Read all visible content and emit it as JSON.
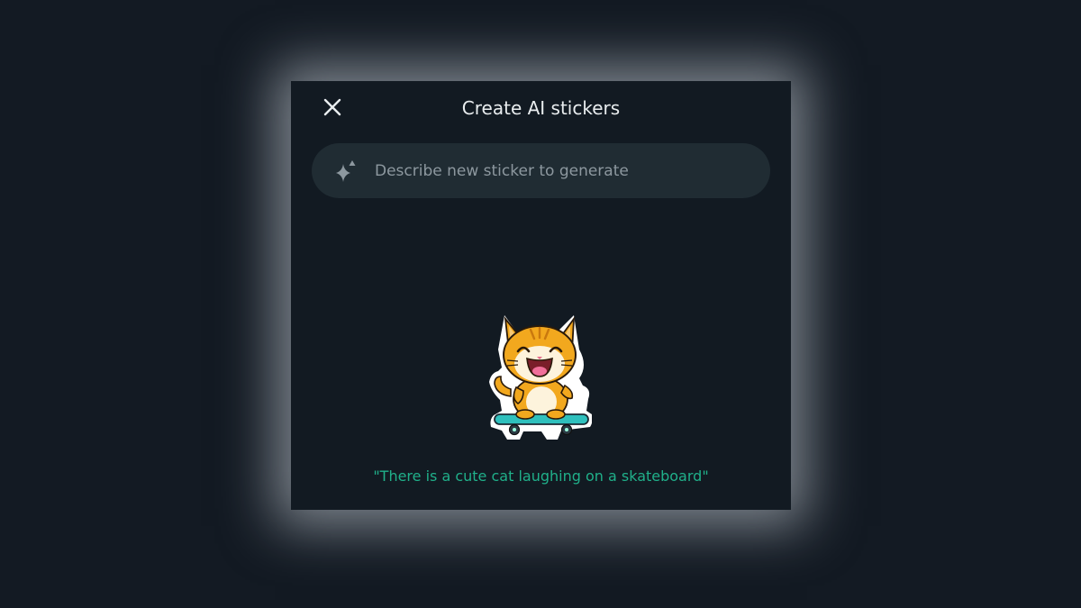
{
  "dialog": {
    "title": "Create AI stickers",
    "close_icon": "close-icon"
  },
  "search": {
    "icon": "sparkle-icon",
    "placeholder": "Describe new sticker to generate",
    "value": ""
  },
  "sticker": {
    "icon": "cat-skateboard-sticker"
  },
  "caption": "\"There is a cute cat laughing on a skateboard\"",
  "colors": {
    "background": "#131a23",
    "panel": "#121a22",
    "search_field": "#202c33",
    "caption": "#20b08a",
    "title": "#e9edef"
  }
}
